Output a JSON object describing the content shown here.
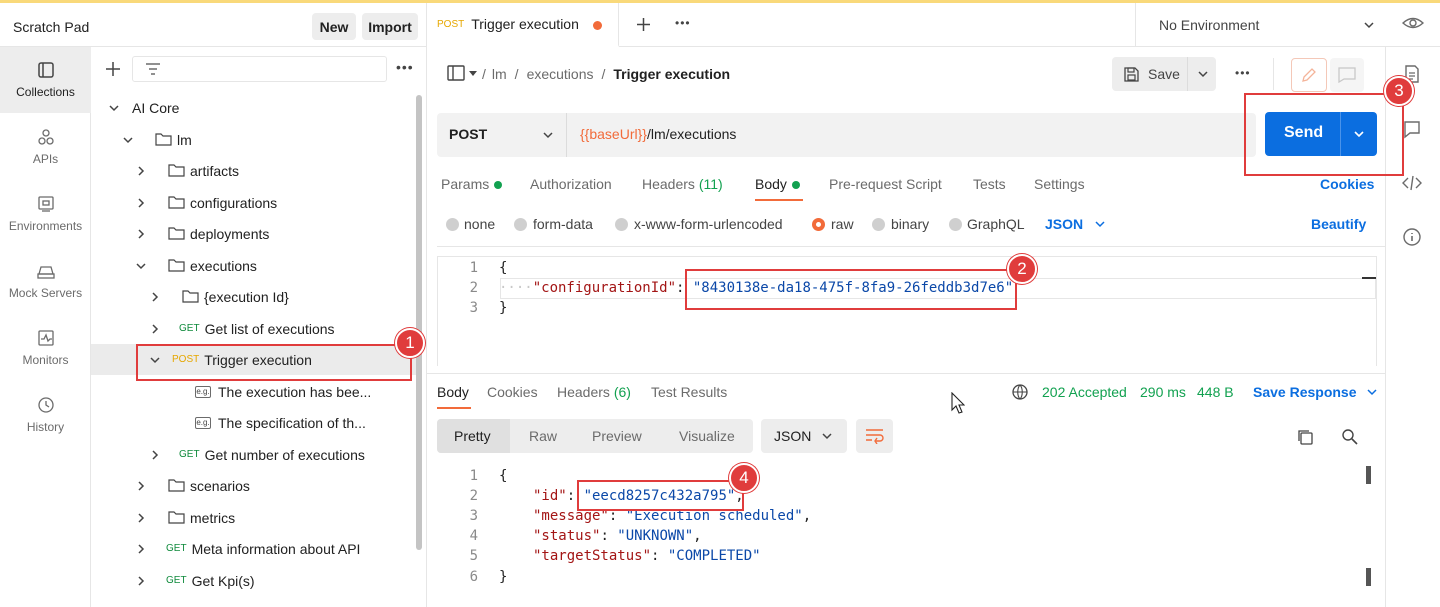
{
  "sidebar_header": {
    "title": "Scratch Pad",
    "new_label": "New",
    "import_label": "Import"
  },
  "rail": [
    {
      "label": "Collections",
      "icon": "collections-icon"
    },
    {
      "label": "APIs",
      "icon": "apis-icon"
    },
    {
      "label": "Environments",
      "icon": "environments-icon"
    },
    {
      "label": "Mock Servers",
      "icon": "mock-servers-icon"
    },
    {
      "label": "Monitors",
      "icon": "monitors-icon"
    },
    {
      "label": "History",
      "icon": "history-icon"
    }
  ],
  "tree": {
    "root": "AI Core",
    "lm": "lm",
    "artifacts": "artifacts",
    "configurations": "configurations",
    "deployments": "deployments",
    "executions": "executions",
    "execution_id": "{execution Id}",
    "get_list": "Get list of executions",
    "trigger": "Trigger execution",
    "example1": "The execution has bee...",
    "example2": "The specification of th...",
    "get_number": "Get number of executions",
    "scenarios": "scenarios",
    "metrics": "metrics",
    "meta": "Meta information about API",
    "kpi": "Get Kpi(s)",
    "get": "GET",
    "post": "POST",
    "eg": "e.g."
  },
  "tab": {
    "method": "POST",
    "title": "Trigger execution"
  },
  "environment": "No Environment",
  "breadcrumb": {
    "part1": "lm",
    "part2": "executions",
    "current": "Trigger execution"
  },
  "save_label": "Save",
  "request": {
    "method": "POST",
    "url_var": "{{baseUrl}}",
    "url_path": "/lm/executions",
    "send_label": "Send"
  },
  "req_tabs": {
    "params": "Params",
    "authorization": "Authorization",
    "headers": "Headers",
    "headers_count": "(11)",
    "body": "Body",
    "prerequest": "Pre-request Script",
    "tests": "Tests",
    "settings": "Settings",
    "cookies": "Cookies"
  },
  "body_types": {
    "none": "none",
    "form_data": "form-data",
    "urlencoded": "x-www-form-urlencoded",
    "raw": "raw",
    "binary": "binary",
    "graphql": "GraphQL",
    "json": "JSON",
    "beautify": "Beautify"
  },
  "req_body": {
    "open": "{",
    "key": "\"configurationId\"",
    "colon": ": ",
    "value": "\"8430138e-da18-475f-8fa9-26feddb3d7e6\"",
    "close": "}",
    "indent": "····"
  },
  "resp_tabs": {
    "body": "Body",
    "cookies": "Cookies",
    "headers": "Headers",
    "headers_count": "(6)",
    "test_results": "Test Results"
  },
  "resp_status": {
    "status": "202 Accepted",
    "time": "290 ms",
    "size": "448 B",
    "save": "Save Response"
  },
  "resp_view": {
    "pretty": "Pretty",
    "raw": "Raw",
    "preview": "Preview",
    "visualize": "Visualize",
    "json": "JSON"
  },
  "resp_body": {
    "open": "{",
    "id_key": "\"id\"",
    "id_val": "\"eecd8257c432a795\"",
    "msg_key": "\"message\"",
    "msg_val": "\"Execution scheduled\"",
    "status_key": "\"status\"",
    "status_val": "\"UNKNOWN\"",
    "target_key": "\"targetStatus\"",
    "target_val": "\"COMPLETED\"",
    "close": "}",
    "colon": ": ",
    "comma": ","
  },
  "line_numbers": {
    "n1": "1",
    "n2": "2",
    "n3": "3",
    "n4": "4",
    "n5": "5",
    "n6": "6"
  },
  "annotations": {
    "a1": "1",
    "a2": "2",
    "a3": "3",
    "a4": "4"
  },
  "colors": {
    "send": "#0b6ee0",
    "annotation": "#e03c3c",
    "get": "#0f8a3c",
    "post": "#e6a700",
    "status_ok": "#12a150"
  }
}
